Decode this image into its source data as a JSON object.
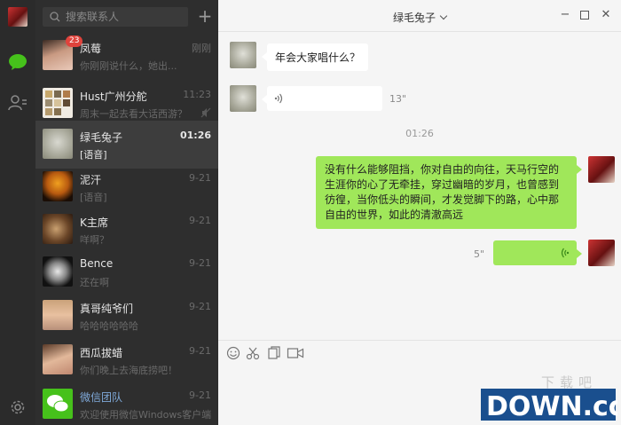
{
  "search": {
    "placeholder": "搜索联系人"
  },
  "sessions": [
    {
      "name": "凤莓",
      "time": "刚刚",
      "preview": "你刚刚说什么，她出...",
      "badge": "23"
    },
    {
      "name": "Hust广州分舵",
      "time": "11:23",
      "preview": "周末一起去看大话西游？"
    },
    {
      "name": "绿毛兔子",
      "time": "01:26",
      "preview": "[语音]"
    },
    {
      "name": "泥汗",
      "time": "9-21",
      "preview": "[语音]"
    },
    {
      "name": "K主席",
      "time": "9-21",
      "preview": "咩啊？"
    },
    {
      "name": "Bence",
      "time": "9-21",
      "preview": "还在啊"
    },
    {
      "name": "真哥纯爷们",
      "time": "9-21",
      "preview": "哈哈哈哈哈哈"
    },
    {
      "name": "西瓜拔蜡",
      "time": "9-21",
      "preview": "你们晚上去海底捞吧！"
    },
    {
      "name": "微信团队",
      "time": "9-21",
      "preview": "欢迎使用微信Windows客户端"
    }
  ],
  "chat": {
    "title": "绿毛兔子",
    "msg1": "年会大家唱什么？",
    "voice1_duration": "13\"",
    "time_separator": "01:26",
    "msg2": "没有什么能够阻挡，你对自由的向往，天马行空的生涯你的心了无牵挂，穿过幽暗的岁月，也曾感到彷徨，当你低头的瞬间，才发觉脚下的路，心中那自由的世界，如此的清澈高远",
    "voice2_duration": "5\""
  },
  "watermark": {
    "text": "DOWN.cc",
    "sub": "下载吧"
  },
  "colors": {
    "accent_green": "#46c11b",
    "bubble_out": "#a0e75a",
    "badge": "#e0433c"
  }
}
